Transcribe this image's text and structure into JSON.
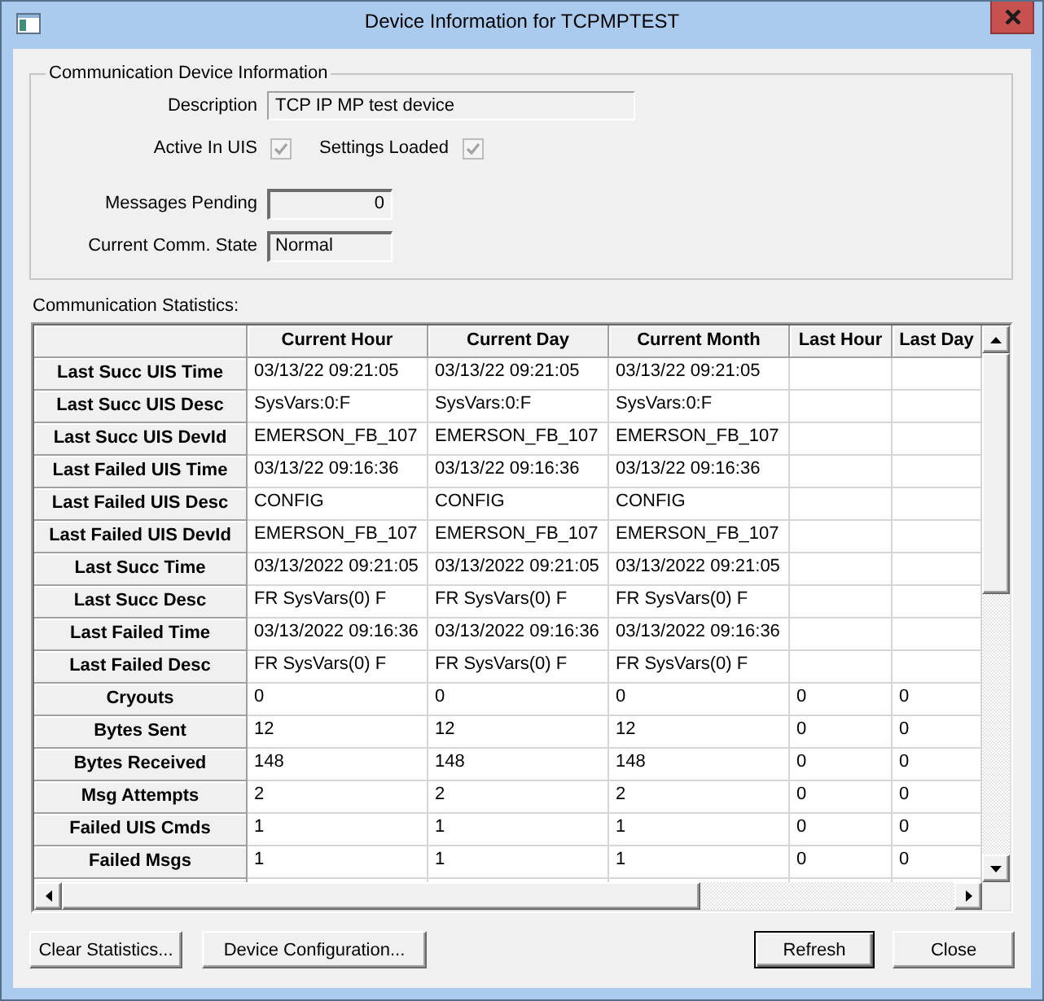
{
  "window": {
    "title": "Device Information for TCPMPTEST"
  },
  "device_info": {
    "title": "Communication Device Information",
    "description": {
      "label": "Description",
      "value": "TCP IP MP test device"
    },
    "active_in_uis": {
      "label": "Active In UIS",
      "checked": true,
      "disabled": true
    },
    "settings_loaded": {
      "label": "Settings Loaded",
      "checked": true,
      "disabled": true
    },
    "messages_pending": {
      "label": "Messages Pending",
      "value": "0"
    },
    "comm_state": {
      "label": "Current Comm. State",
      "value": "Normal"
    }
  },
  "statistics": {
    "title": "Communication Statistics:",
    "columns": [
      "Current Hour",
      "Current Day",
      "Current Month",
      "Last Hour",
      "Last Day"
    ],
    "rows": [
      {
        "label": "Last Succ UIS Time",
        "values": [
          "03/13/22 09:21:05",
          "03/13/22 09:21:05",
          "03/13/22 09:21:05"
        ]
      },
      {
        "label": "Last Succ UIS Desc",
        "values": [
          "SysVars:0:F",
          "SysVars:0:F",
          "SysVars:0:F"
        ]
      },
      {
        "label": "Last Succ UIS DevId",
        "values": [
          "EMERSON_FB_107",
          "EMERSON_FB_107",
          "EMERSON_FB_107"
        ]
      },
      {
        "label": "Last Failed UIS Time",
        "values": [
          "03/13/22 09:16:36",
          "03/13/22 09:16:36",
          "03/13/22 09:16:36"
        ]
      },
      {
        "label": "Last Failed UIS Desc",
        "values": [
          "CONFIG",
          "CONFIG",
          "CONFIG"
        ]
      },
      {
        "label": "Last Failed UIS DevId",
        "values": [
          "EMERSON_FB_107",
          "EMERSON_FB_107",
          "EMERSON_FB_107"
        ]
      },
      {
        "label": "Last Succ Time",
        "values": [
          "03/13/2022 09:21:05",
          "03/13/2022 09:21:05",
          "03/13/2022 09:21:05"
        ]
      },
      {
        "label": "Last Succ Desc",
        "values": [
          "FR SysVars(0) F",
          "FR SysVars(0) F",
          "FR SysVars(0) F"
        ]
      },
      {
        "label": "Last Failed Time",
        "values": [
          "03/13/2022 09:16:36",
          "03/13/2022 09:16:36",
          "03/13/2022 09:16:36"
        ]
      },
      {
        "label": "Last Failed Desc",
        "values": [
          "FR SysVars(0) F",
          "FR SysVars(0) F",
          "FR SysVars(0) F"
        ]
      },
      {
        "label": "Cryouts",
        "values": [
          "0",
          "0",
          "0",
          "0",
          "0"
        ]
      },
      {
        "label": "Bytes Sent",
        "values": [
          "12",
          "12",
          "12",
          "0",
          "0"
        ]
      },
      {
        "label": "Bytes Received",
        "values": [
          "148",
          "148",
          "148",
          "0",
          "0"
        ]
      },
      {
        "label": "Msg Attempts",
        "values": [
          "2",
          "2",
          "2",
          "0",
          "0"
        ]
      },
      {
        "label": "Failed UIS Cmds",
        "values": [
          "1",
          "1",
          "1",
          "0",
          "0"
        ]
      },
      {
        "label": "Failed Msgs",
        "values": [
          "1",
          "1",
          "1",
          "0",
          "0"
        ]
      }
    ]
  },
  "left_buttons": [
    {
      "label": "Clear Statistics...",
      "default": false
    },
    {
      "label": "Device Configuration...",
      "default": false
    }
  ],
  "right_buttons": [
    {
      "label": "Refresh",
      "default": true
    },
    {
      "label": "Close",
      "default": false
    }
  ]
}
